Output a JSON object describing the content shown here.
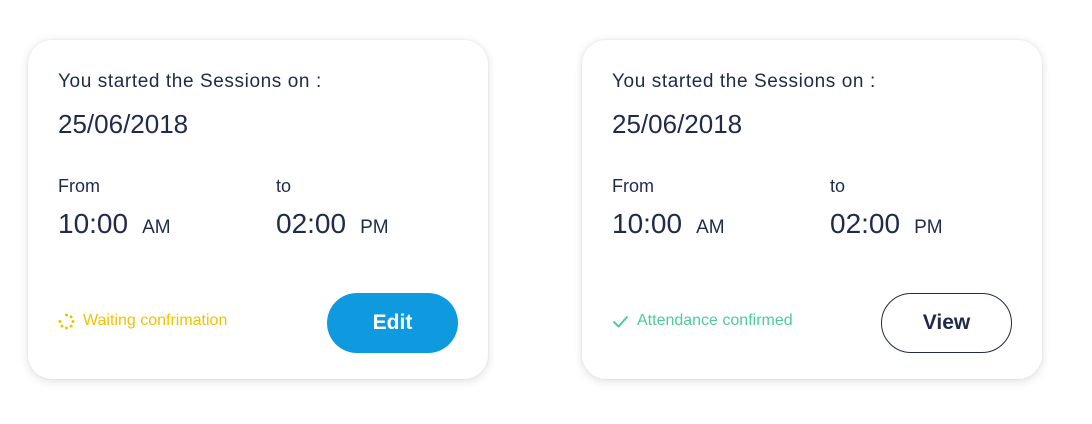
{
  "cards": [
    {
      "intro": "You started the Sessions on :",
      "date": "25/06/2018",
      "from_label": "From",
      "to_label": "to",
      "from_time": "10:00",
      "from_period": "AM",
      "to_time": "02:00",
      "to_period": "PM",
      "status_text": "Waiting confrimation",
      "status_icon": "spinner-icon",
      "status_color": "#f2c200",
      "button_label": "Edit",
      "button_color": "#0f9ae0"
    },
    {
      "intro": "You started the Sessions on :",
      "date": "25/06/2018",
      "from_label": "From",
      "to_label": "to",
      "from_time": "10:00",
      "from_period": "AM",
      "to_time": "02:00",
      "to_period": "PM",
      "status_text": "Attendance confirmed",
      "status_icon": "check-icon",
      "status_color": "#4ecb9a",
      "button_label": "View",
      "button_color": "#ffffff"
    }
  ]
}
